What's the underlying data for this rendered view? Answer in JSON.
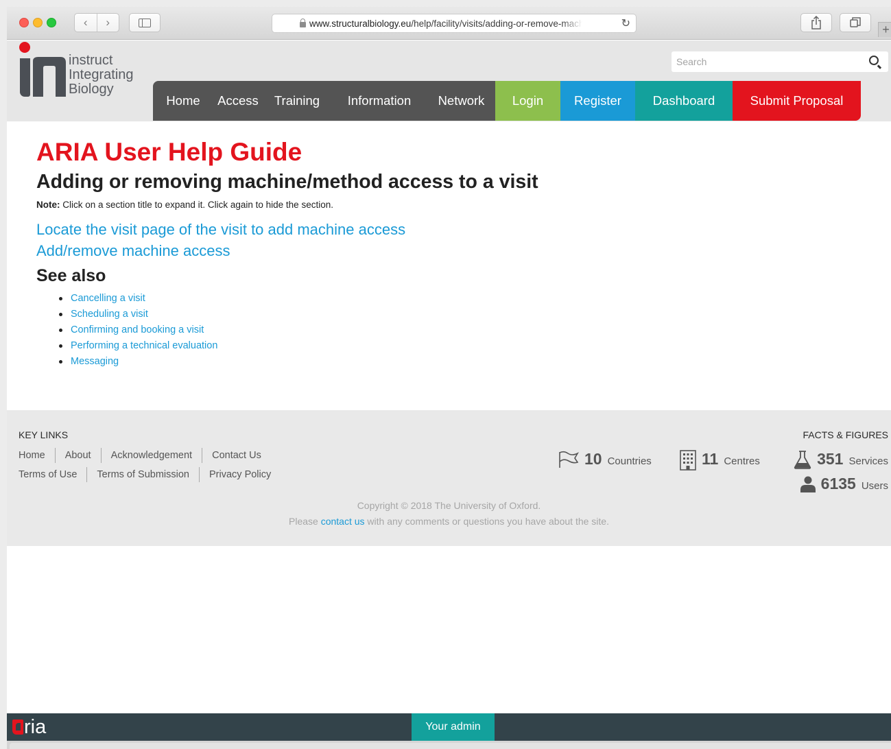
{
  "browser": {
    "url_host": "www.structuralbiology.eu",
    "url_path": "/help/facility/visits/adding-or-remove-machine-access"
  },
  "logo": {
    "line1": "instruct",
    "line2": "Integrating",
    "line3": "Biology"
  },
  "search": {
    "placeholder": "Search"
  },
  "nav": {
    "home": "Home",
    "access": "Access",
    "training": "Training",
    "information": "Information",
    "network": "Network",
    "login": "Login",
    "register": "Register",
    "dashboard": "Dashboard",
    "submit": "Submit Proposal"
  },
  "colors": {
    "brand_red": "#e3141e",
    "link_blue": "#1a9ad6",
    "login_green": "#8dbf4d",
    "teal": "#13a19c",
    "nav_dark": "#545454"
  },
  "content": {
    "title": "ARIA User Help Guide",
    "subtitle": "Adding or removing machine/method access to a visit",
    "note_label": "Note:",
    "note_text": " Click on a section title to expand it. Click again to hide the section.",
    "sections": [
      "Locate the visit page of the visit to add machine access",
      "Add/remove machine access"
    ],
    "see_also": "See also",
    "related": [
      "Cancelling a visit",
      "Scheduling a visit",
      "Confirming and booking a visit",
      "Performing a technical evaluation",
      "Messaging"
    ]
  },
  "footer": {
    "key_links_title": "KEY LINKS",
    "links_row1": [
      "Home",
      "About",
      "Acknowledgement",
      "Contact Us"
    ],
    "links_row2": [
      "Terms of Use",
      "Terms of Submission",
      "Privacy Policy"
    ],
    "facts_title": "FACTS & FIGURES",
    "facts": [
      {
        "icon": "flag-icon",
        "value": "10",
        "label": "Countries"
      },
      {
        "icon": "building-icon",
        "value": "11",
        "label": "Centres"
      },
      {
        "icon": "flask-icon",
        "value": "351",
        "label": "Services"
      },
      {
        "icon": "user-icon",
        "value": "6135",
        "label": "Users"
      }
    ],
    "copyright": "Copyright © 2018 The University of Oxford.",
    "contact_pre": "Please ",
    "contact_link": "contact us",
    "contact_post": " with any comments or questions you have about the site."
  },
  "aria_bar": {
    "logo_text": "ria",
    "your_admin": "Your admin"
  }
}
